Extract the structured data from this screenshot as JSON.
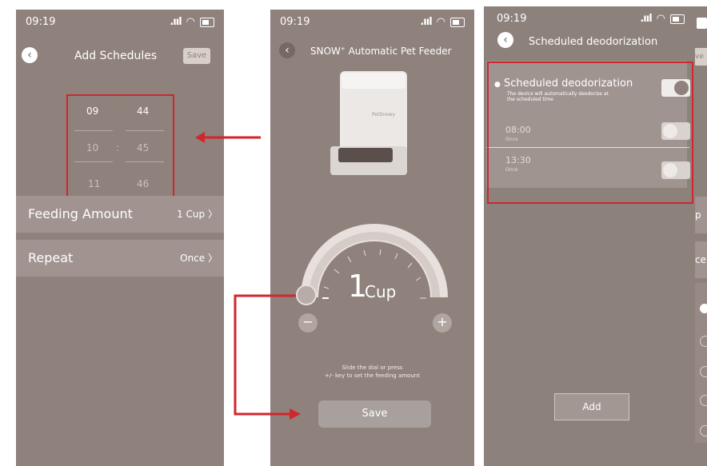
{
  "screen1": {
    "status": {
      "time": "09:19"
    },
    "title": "Add Schedules",
    "save_label": "Save",
    "picker": {
      "hours": [
        "09",
        "10",
        "11"
      ],
      "minutes": [
        "44",
        "45",
        "46"
      ],
      "separator": ":"
    },
    "rows": [
      {
        "label": "Feeding Amount",
        "value": "1 Cup"
      },
      {
        "label": "Repeat",
        "value": "Once"
      }
    ]
  },
  "screen2": {
    "status": {
      "time": "09:19"
    },
    "title": "SNOW",
    "title_sup": "+",
    "title_rest": " Automatic Pet Feeder",
    "device_brand": "PetSnowy",
    "dial": {
      "value": "1",
      "unit": "Cup"
    },
    "hint_line1": "Slide the dial or press",
    "hint_line2": "+/- key to set the feeding amount",
    "save_label": "Save"
  },
  "screen3": {
    "status": {
      "time": "09:19"
    },
    "title": "Scheduled deodorization",
    "deodorization": {
      "label": "Scheduled deodorization",
      "description_line1": "The device will automatically deodorize at",
      "description_line2": "the scheduled time",
      "enabled": true
    },
    "schedules": [
      {
        "time": "08:00",
        "repeat": "Once",
        "enabled": false
      },
      {
        "time": "13:30",
        "repeat": "Once",
        "enabled": false
      }
    ],
    "add_label": "Add"
  },
  "screen4_partial": {
    "fragments": [
      "ve",
      "p",
      "ce"
    ]
  },
  "colors": {
    "background": "#8f817b",
    "panel": "#a19490",
    "highlight": "#d0262d"
  }
}
